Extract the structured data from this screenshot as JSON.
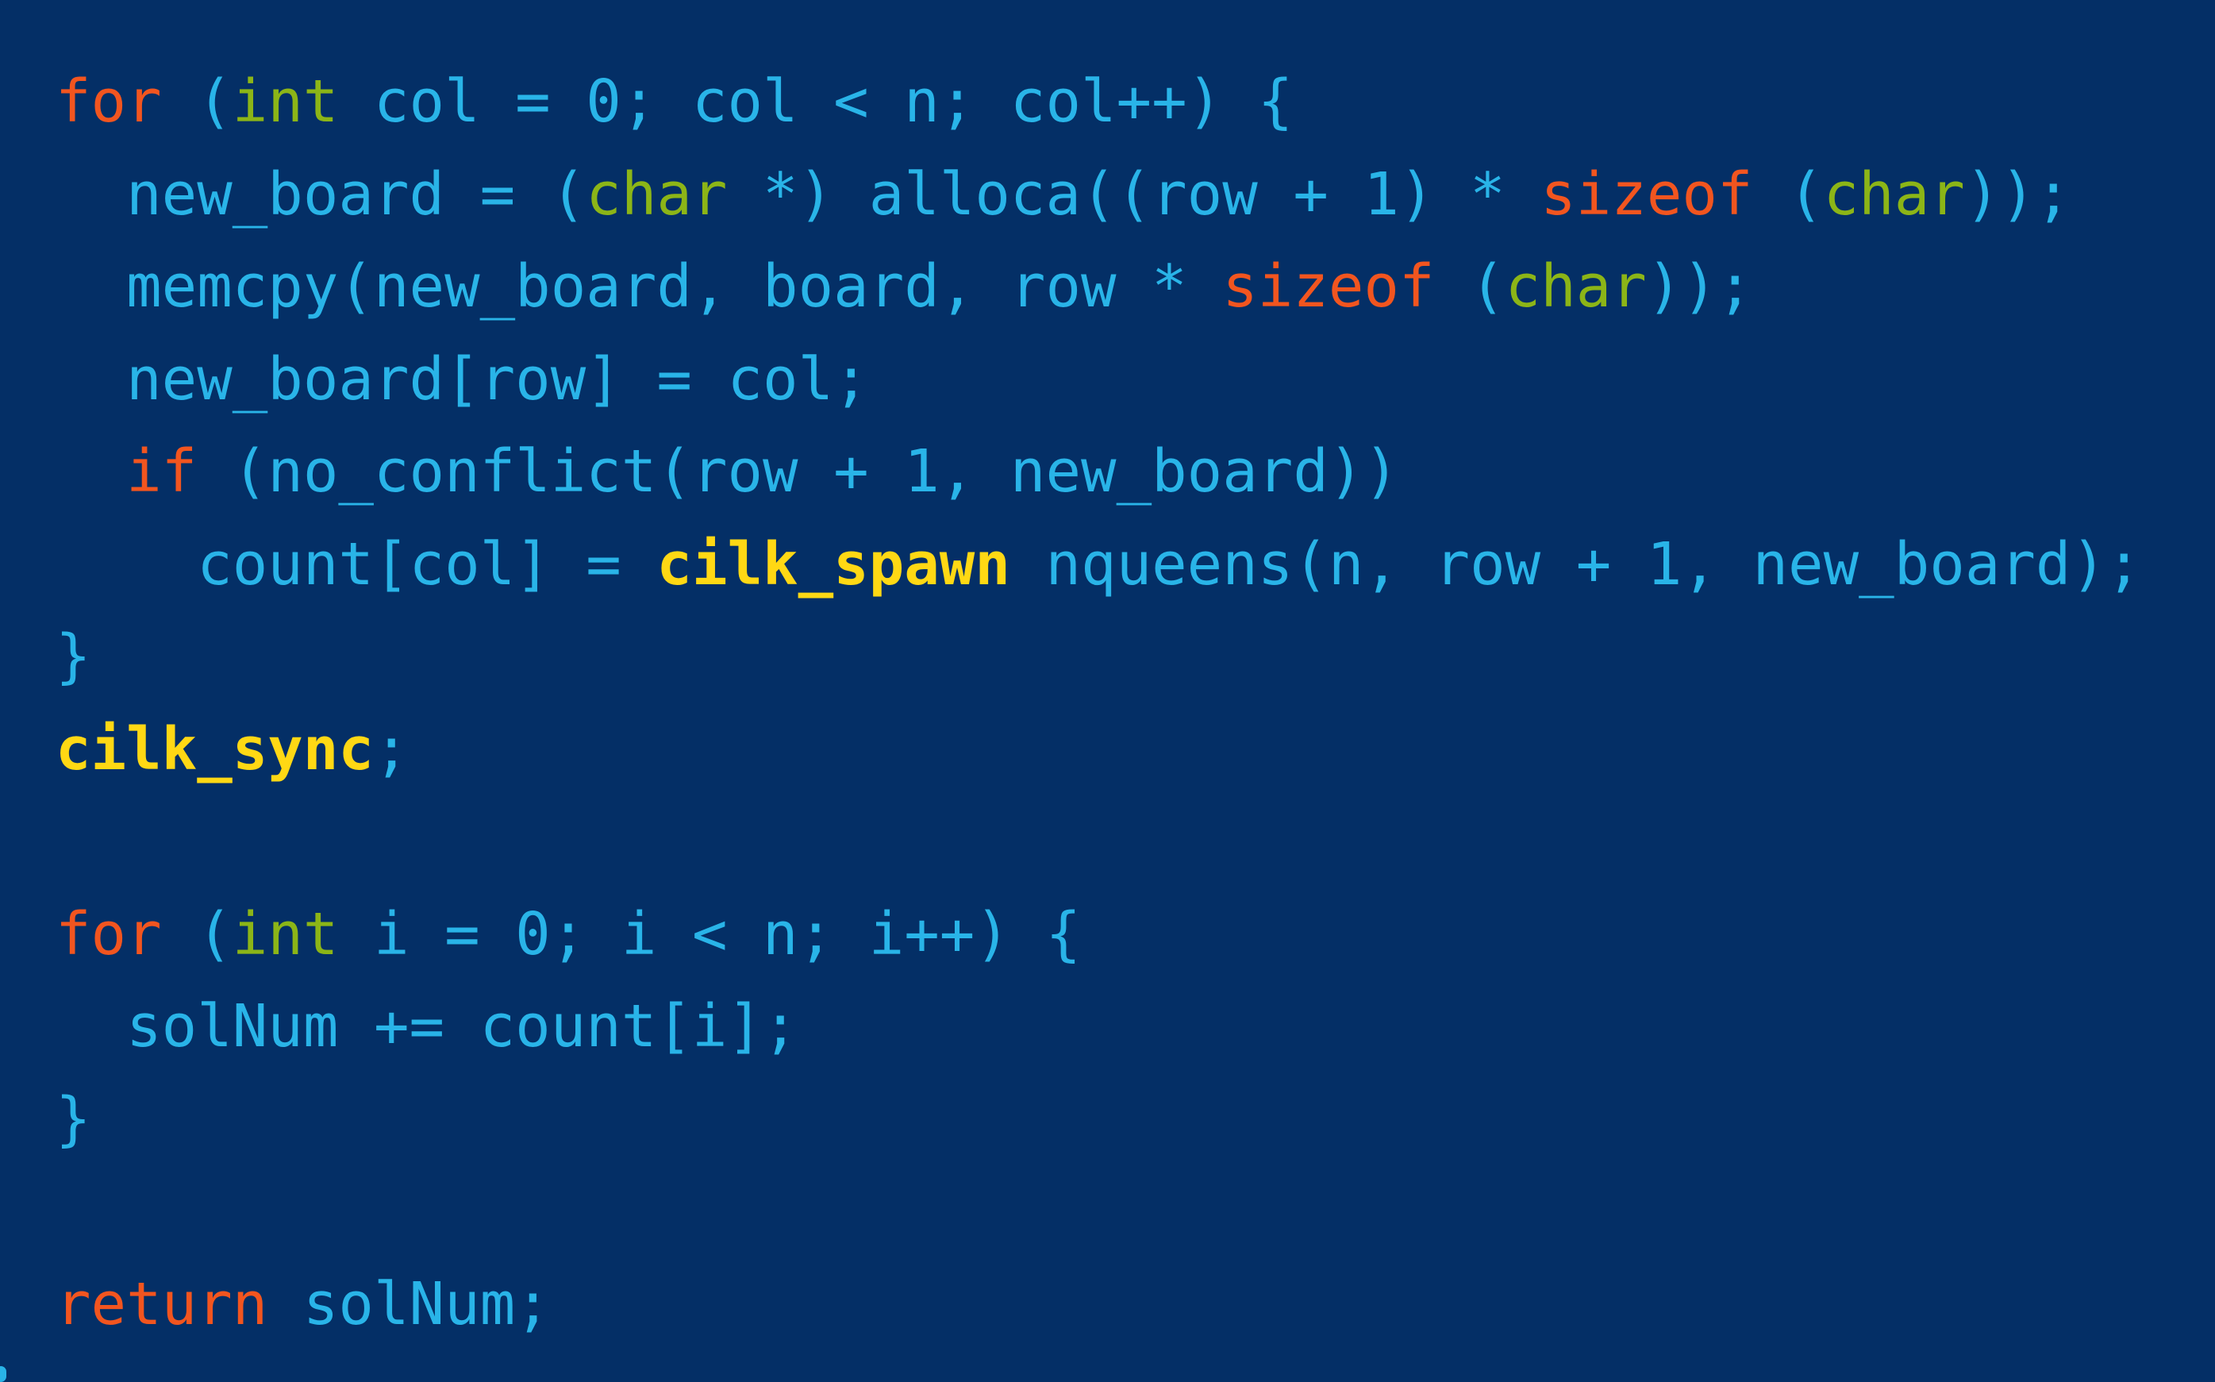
{
  "colors": {
    "background": "#042f66",
    "keyword": "#f2551f",
    "type": "#8cb517",
    "plain": "#29b4e8",
    "cilk": "#ffd814"
  },
  "code": {
    "lines": [
      {
        "tokens": [
          {
            "text": "for",
            "kind": "keyword"
          },
          {
            "text": " (",
            "kind": "plain"
          },
          {
            "text": "int",
            "kind": "type"
          },
          {
            "text": " col = 0; col < n; col++) {",
            "kind": "plain"
          }
        ]
      },
      {
        "tokens": [
          {
            "text": "  new_board = (",
            "kind": "plain"
          },
          {
            "text": "char",
            "kind": "type"
          },
          {
            "text": " *) alloca((row + 1) * ",
            "kind": "plain"
          },
          {
            "text": "sizeof",
            "kind": "keyword"
          },
          {
            "text": " (",
            "kind": "plain"
          },
          {
            "text": "char",
            "kind": "type"
          },
          {
            "text": "));",
            "kind": "plain"
          }
        ]
      },
      {
        "tokens": [
          {
            "text": "  memcpy(new_board, board, row * ",
            "kind": "plain"
          },
          {
            "text": "sizeof",
            "kind": "keyword"
          },
          {
            "text": " (",
            "kind": "plain"
          },
          {
            "text": "char",
            "kind": "type"
          },
          {
            "text": "));",
            "kind": "plain"
          }
        ]
      },
      {
        "tokens": [
          {
            "text": "  new_board[row] = col;",
            "kind": "plain"
          }
        ]
      },
      {
        "tokens": [
          {
            "text": "  ",
            "kind": "plain"
          },
          {
            "text": "if",
            "kind": "keyword"
          },
          {
            "text": " (no_conflict(row + 1, new_board))",
            "kind": "plain"
          }
        ]
      },
      {
        "tokens": [
          {
            "text": "    count[col] = ",
            "kind": "plain"
          },
          {
            "text": "cilk_spawn",
            "kind": "cilk"
          },
          {
            "text": " nqueens(n, row + 1, new_board);",
            "kind": "plain"
          }
        ]
      },
      {
        "tokens": [
          {
            "text": "}",
            "kind": "plain"
          }
        ]
      },
      {
        "tokens": [
          {
            "text": "cilk_sync",
            "kind": "cilk"
          },
          {
            "text": ";",
            "kind": "plain"
          }
        ]
      },
      {
        "tokens": []
      },
      {
        "tokens": [
          {
            "text": "for",
            "kind": "keyword"
          },
          {
            "text": " (",
            "kind": "plain"
          },
          {
            "text": "int",
            "kind": "type"
          },
          {
            "text": " i = 0; i < n; i++) {",
            "kind": "plain"
          }
        ]
      },
      {
        "tokens": [
          {
            "text": "  solNum += count[i];",
            "kind": "plain"
          }
        ]
      },
      {
        "tokens": [
          {
            "text": "}",
            "kind": "plain"
          }
        ]
      },
      {
        "tokens": []
      },
      {
        "tokens": [
          {
            "text": "return",
            "kind": "keyword"
          },
          {
            "text": " solNum;",
            "kind": "plain"
          }
        ]
      }
    ]
  }
}
